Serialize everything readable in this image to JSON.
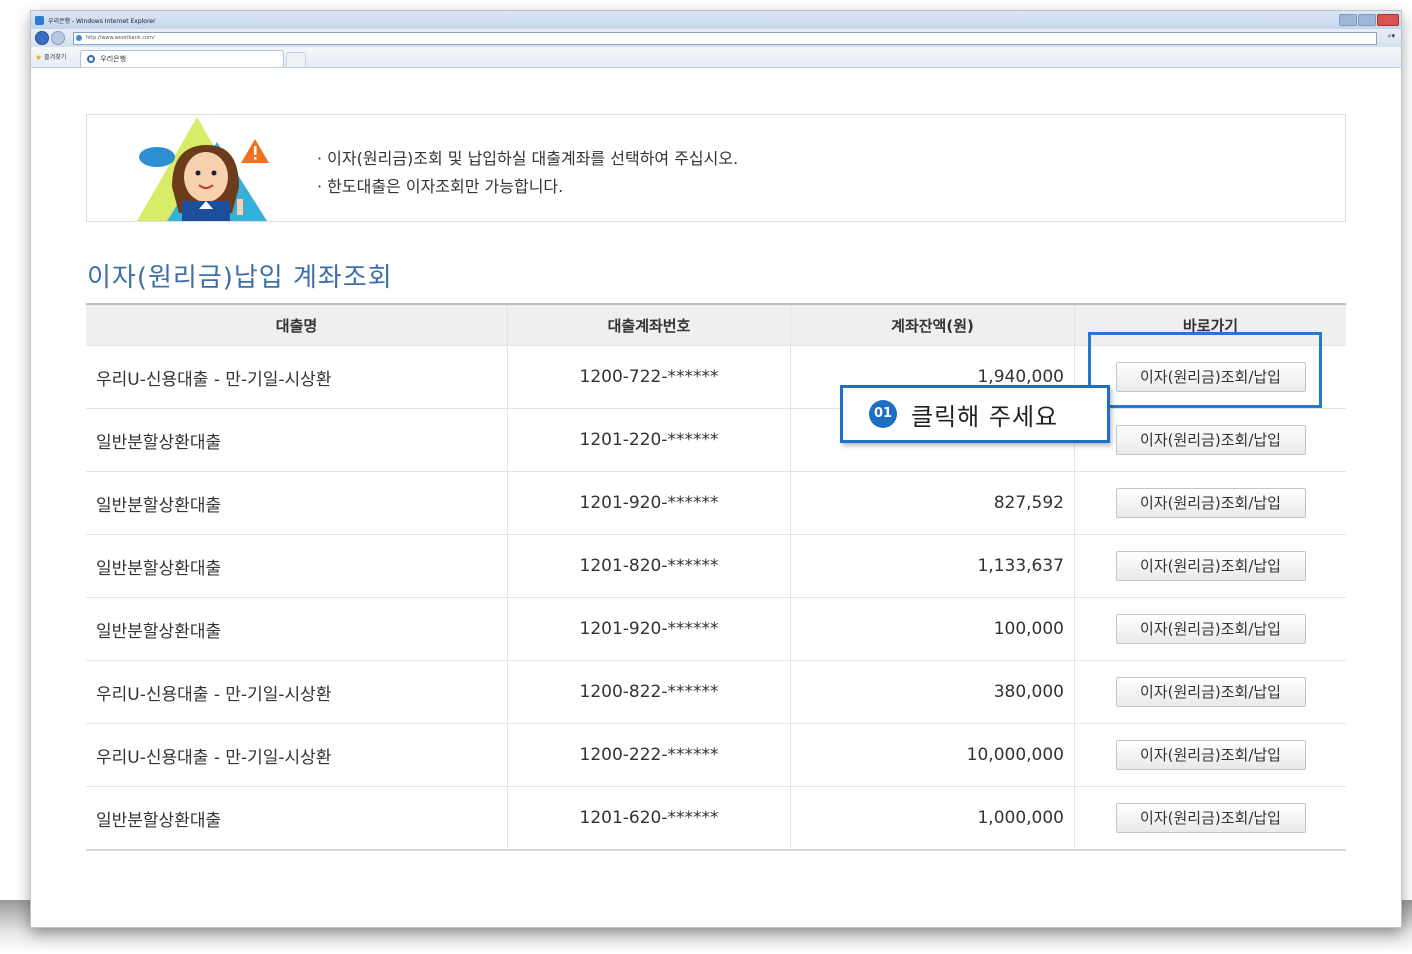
{
  "browser": {
    "title": "우리은행 - Windows Internet Explorer",
    "url": "http://www.wooribank.com/",
    "favorites_label": "즐겨찾기",
    "tab_label": "우리은행"
  },
  "notice": {
    "lines": [
      "이자(원리금)조회 및 납입하실 대출계좌를 선택하여 주십시오.",
      "한도대출은 이자조회만 가능합니다."
    ]
  },
  "section_title": "이자(원리금)납입 계좌조회",
  "table": {
    "headers": [
      "대출명",
      "대출계좌번호",
      "계좌잔액(원)",
      "바로가기"
    ],
    "button_label": "이자(원리금)조회/납입",
    "rows": [
      {
        "name": "우리U-신용대출 - 만-기일-시상환",
        "account": "1200-722-******",
        "balance": "1,940,000"
      },
      {
        "name": "일반분할상환대출",
        "account": "1201-220-******",
        "balance": ""
      },
      {
        "name": "일반분할상환대출",
        "account": "1201-920-******",
        "balance": "827,592"
      },
      {
        "name": "일반분할상환대출",
        "account": "1201-820-******",
        "balance": "1,133,637"
      },
      {
        "name": "일반분할상환대출",
        "account": "1201-920-******",
        "balance": "100,000"
      },
      {
        "name": "우리U-신용대출 - 만-기일-시상환",
        "account": "1200-822-******",
        "balance": "380,000"
      },
      {
        "name": "우리U-신용대출 - 만-기일-시상환",
        "account": "1200-222-******",
        "balance": "10,000,000"
      },
      {
        "name": "일반분할상환대출",
        "account": "1201-620-******",
        "balance": "1,000,000"
      }
    ]
  },
  "callout": {
    "badge": "01",
    "text": "클릭해 주세요"
  },
  "colors": {
    "accent": "#1e6ec6",
    "title": "#3e6fa8",
    "warning": "#f36f21"
  }
}
